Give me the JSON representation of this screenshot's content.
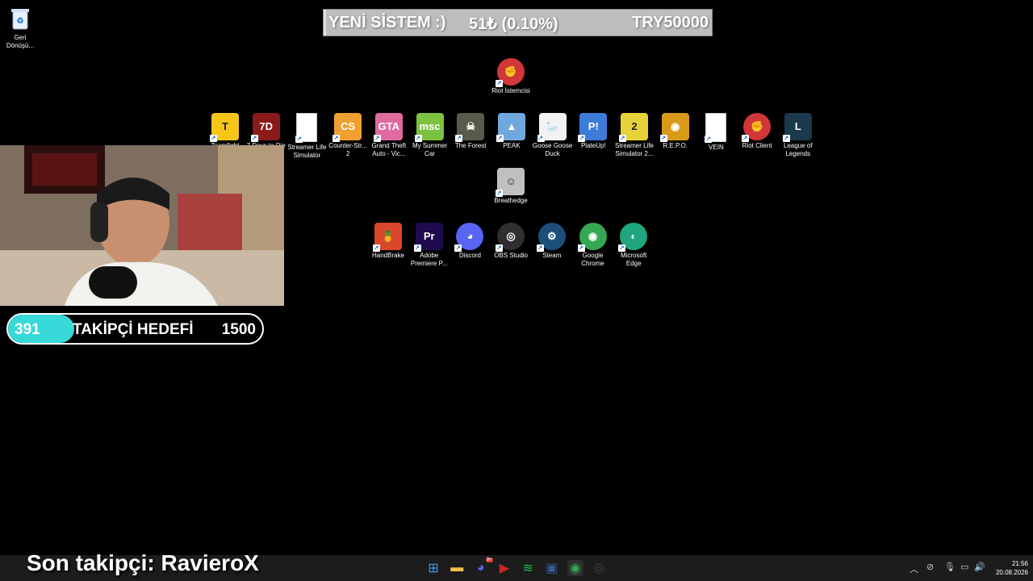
{
  "donation": {
    "title": "YENİ SİSTEM :)",
    "amount": "51₺ (0.10%)",
    "goal": "TRY50000",
    "progress_percent": 0.1
  },
  "desktop": {
    "recycle_bin": {
      "label": "Geri Dönüşü...",
      "icon": "recycle-bin-icon"
    },
    "row1": [
      {
        "label": "Riot İstemcisi",
        "icon": "riot-icon",
        "color": "#d13639"
      }
    ],
    "row2": [
      {
        "label": "Teamfight",
        "icon": "teamfight-icon",
        "color": "#f5c518"
      },
      {
        "label": "7 Days to Die",
        "icon": "7-days-to-die-icon",
        "color": "#8b1a1a"
      },
      {
        "label": "Streamer Life Simulator",
        "icon": "file-icon",
        "color": "#ffffff"
      },
      {
        "label": "Counter-Str... 2",
        "icon": "counter-strike-icon",
        "color": "#f0a030"
      },
      {
        "label": "Grand Theft Auto - Vic...",
        "icon": "gta-vice-city-icon",
        "color": "#e06aa0"
      },
      {
        "label": "My Summer Car",
        "icon": "my-summer-car-icon",
        "color": "#7cc242"
      },
      {
        "label": "The Forest",
        "icon": "the-forest-icon",
        "color": "#5a5a4a"
      },
      {
        "label": "PEAK",
        "icon": "peak-icon",
        "color": "#6fa8dc"
      },
      {
        "label": "Goose Goose Duck",
        "icon": "goose-goose-duck-icon",
        "color": "#f2f2f2"
      },
      {
        "label": "PlateUp!",
        "icon": "plateup-icon",
        "color": "#3d7bd9"
      },
      {
        "label": "Streamer Life Simulator 2...",
        "icon": "streamer-life-2-icon",
        "color": "#e8d23a"
      },
      {
        "label": "R.E.P.O.",
        "icon": "repo-icon",
        "color": "#d99a1a"
      },
      {
        "label": "VEIN",
        "icon": "file-icon",
        "color": "#ffffff"
      },
      {
        "label": "Riot Client",
        "icon": "riot-client-icon",
        "color": "#d13639"
      },
      {
        "label": "League of Legends",
        "icon": "league-of-legends-icon",
        "color": "#1b3a4b"
      }
    ],
    "row3": [
      {
        "label": "Breathedge",
        "icon": "breathedge-icon",
        "color": "#c0c0c0"
      }
    ],
    "row4": [
      {
        "label": "HandBrake",
        "icon": "handbrake-icon",
        "color": "#d9482a"
      },
      {
        "label": "Adobe Premiere P...",
        "icon": "premiere-pro-icon",
        "color": "#1f0a4d"
      },
      {
        "label": "Discord",
        "icon": "discord-icon",
        "color": "#5865f2"
      },
      {
        "label": "OBS Studio",
        "icon": "obs-icon",
        "color": "#302e31"
      },
      {
        "label": "Steam",
        "icon": "steam-icon",
        "color": "#1b4f7a"
      },
      {
        "label": "Google Chrome",
        "icon": "chrome-icon",
        "color": "#34a853"
      },
      {
        "label": "Microsoft Edge",
        "icon": "edge-icon",
        "color": "#1fa67f"
      }
    ]
  },
  "follower_goal": {
    "current": "391",
    "label": "TAKİPÇİ HEDEFİ",
    "target": "1500",
    "progress_fraction": 0.26
  },
  "last_follower": "Son takipçi: RavieroX",
  "taskbar": {
    "apps": [
      {
        "icon": "windows-start-icon"
      },
      {
        "icon": "file-explorer-icon"
      },
      {
        "icon": "discord-icon",
        "badge": "9+"
      },
      {
        "icon": "video-app-icon"
      },
      {
        "icon": "spotify-icon"
      },
      {
        "icon": "app-icon"
      },
      {
        "icon": "chrome-icon"
      },
      {
        "icon": "obs-icon"
      }
    ],
    "time": "21:56",
    "date": "20.08.2026"
  }
}
